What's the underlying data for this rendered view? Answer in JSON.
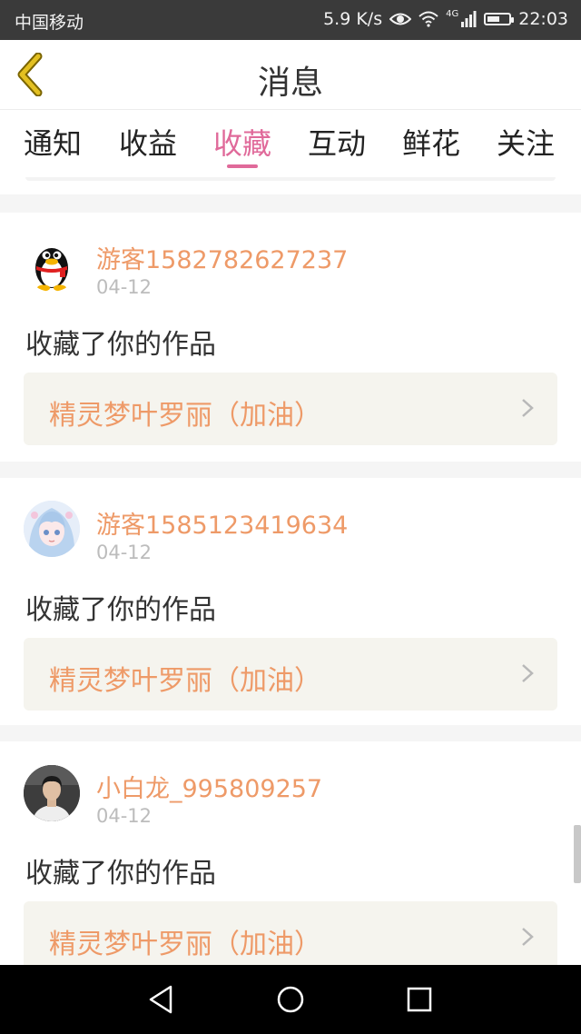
{
  "status_bar": {
    "carrier": "中国移动",
    "speed": "5.9 K/s",
    "network": "4G",
    "time": "22:03",
    "battery_level": 0.6
  },
  "header": {
    "title": "消息"
  },
  "tabs": [
    {
      "label": "通知"
    },
    {
      "label": "收益"
    },
    {
      "label": "收藏",
      "active": true
    },
    {
      "label": "互动"
    },
    {
      "label": "鲜花"
    },
    {
      "label": "关注"
    }
  ],
  "messages": [
    {
      "username": "游客1582782627237",
      "date": "04-12",
      "action": "收藏了你的作品",
      "work_title": "精灵梦叶罗丽（加油）",
      "avatar": "qq-penguin-icon"
    },
    {
      "username": "游客1585123419634",
      "date": "04-12",
      "action": "收藏了你的作品",
      "work_title": "精灵梦叶罗丽（加油）",
      "avatar": "anime-girl-avatar"
    },
    {
      "username": "小白龙_995809257",
      "date": "04-12",
      "action": "收藏了你的作品",
      "work_title": "精灵梦叶罗丽（加油）",
      "avatar": "man-portrait-avatar"
    }
  ],
  "colors": {
    "accent": "#e06a9a",
    "username": "#ee9a68",
    "work_box_bg": "#f5f4ee",
    "back_icon": "#e3c021"
  }
}
